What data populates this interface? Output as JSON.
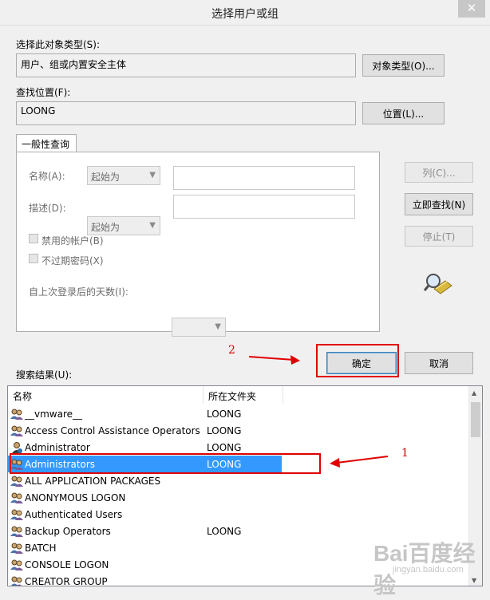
{
  "window": {
    "title": "选择用户或组",
    "close_glyph": "✕"
  },
  "object_type": {
    "label": "选择此对象类型(S):",
    "value": "用户、组或内置安全主体",
    "button": "对象类型(O)..."
  },
  "location": {
    "label": "查找位置(F):",
    "value": "LOONG",
    "button": "位置(L)..."
  },
  "query": {
    "tab": "一般性查询",
    "name_label": "名称(A):",
    "name_mode": "起始为",
    "desc_label": "描述(D):",
    "desc_mode": "起始为",
    "disabled_accounts": "禁用的帐户(B)",
    "non_expiring": "不过期密码(X)",
    "days_label": "自上次登录后的天数(I):"
  },
  "side_buttons": {
    "columns": "列(C)...",
    "find_now": "立即查找(N)",
    "stop": "停止(T)"
  },
  "actions": {
    "ok": "确定",
    "cancel": "取消"
  },
  "results": {
    "label": "搜索结果(U):",
    "headers": [
      "名称",
      "所在文件夹"
    ],
    "rows": [
      {
        "name": "__vmware__",
        "folder": "LOONG",
        "icon": "group-icon"
      },
      {
        "name": "Access Control Assistance Operators",
        "folder": "LOONG",
        "icon": "group-icon"
      },
      {
        "name": "Administrator",
        "folder": "LOONG",
        "icon": "user-icon"
      },
      {
        "name": "Administrators",
        "folder": "LOONG",
        "icon": "group-icon",
        "selected": true
      },
      {
        "name": "ALL APPLICATION PACKAGES",
        "folder": "",
        "icon": "group-icon"
      },
      {
        "name": "ANONYMOUS LOGON",
        "folder": "",
        "icon": "group-icon"
      },
      {
        "name": "Authenticated Users",
        "folder": "",
        "icon": "group-icon"
      },
      {
        "name": "Backup Operators",
        "folder": "LOONG",
        "icon": "group-icon"
      },
      {
        "name": "BATCH",
        "folder": "",
        "icon": "group-icon"
      },
      {
        "name": "CONSOLE LOGON",
        "folder": "",
        "icon": "group-icon"
      },
      {
        "name": "CREATOR GROUP",
        "folder": "",
        "icon": "group-icon"
      }
    ]
  },
  "annotations": {
    "one": "1",
    "two": "2"
  },
  "watermark": {
    "brand": "Bai百度经验",
    "url": "jingyan.baidu.com"
  },
  "colors": {
    "selection": "#3399ff",
    "annotation": "#e00000"
  }
}
